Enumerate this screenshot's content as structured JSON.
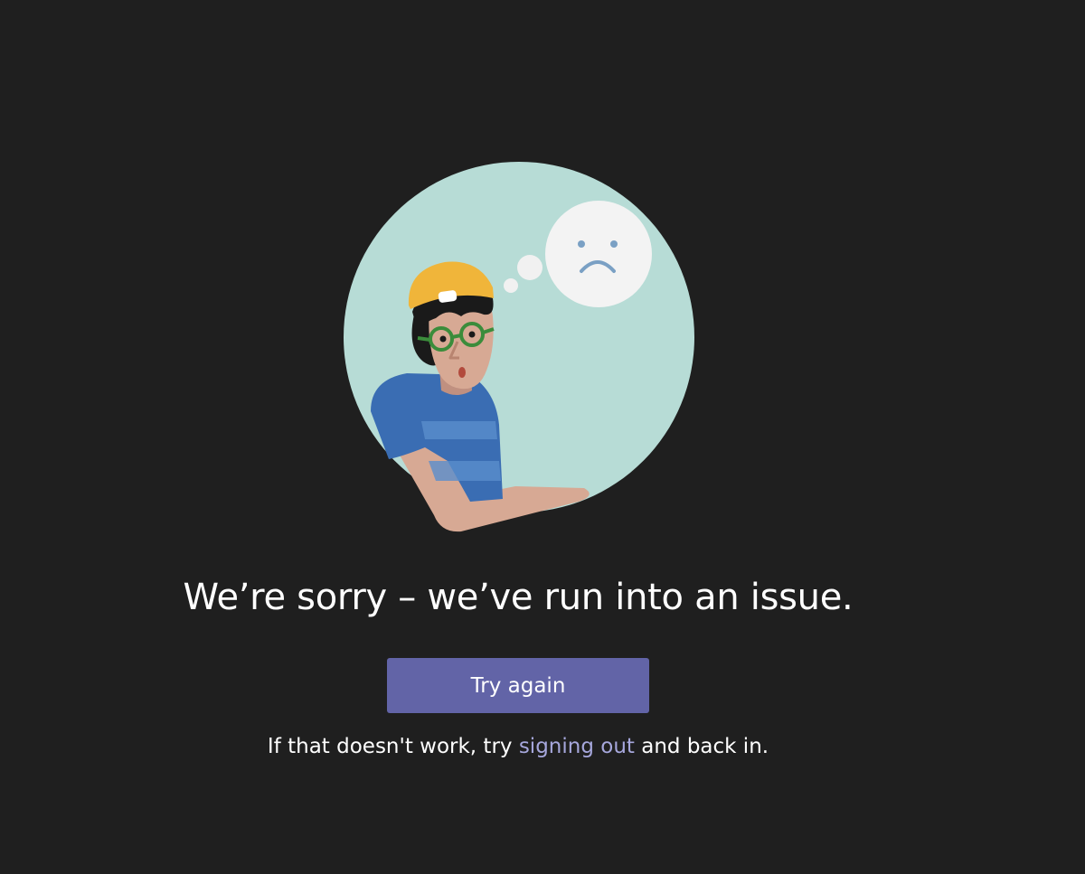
{
  "error": {
    "title": "We’re sorry – we’ve run into an issue.",
    "retry_label": "Try again",
    "hint_before": "If that doesn't work, try ",
    "hint_link": "signing out",
    "hint_after": " and back in."
  },
  "colors": {
    "background": "#1f1f1f",
    "button": "#6264a7",
    "link": "#a6a7dc",
    "circle": "#b7dcd6"
  },
  "icons": {
    "illustration": "sad-person-illustration",
    "thought": "sad-face-icon"
  }
}
